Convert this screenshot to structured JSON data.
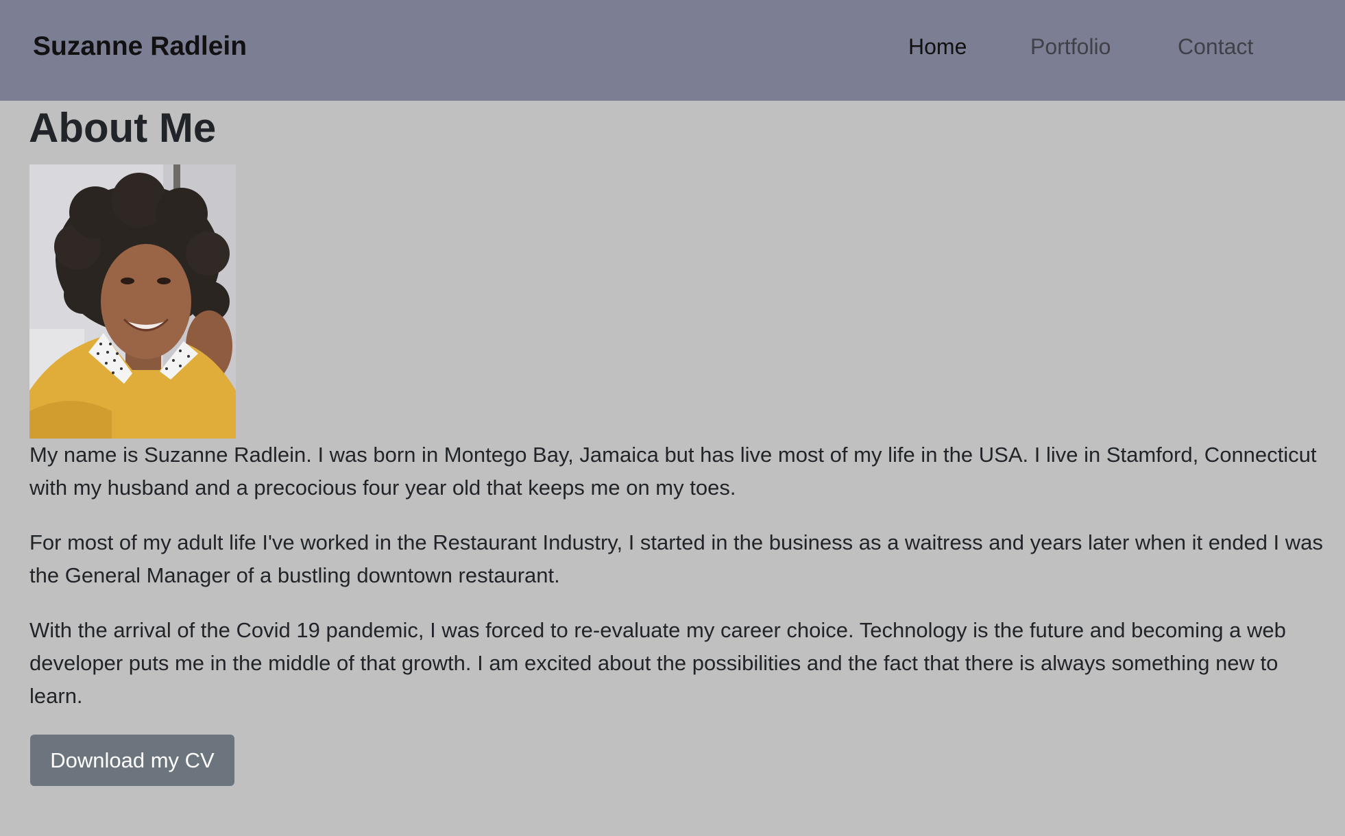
{
  "navbar": {
    "brand": "Suzanne Radlein",
    "links": [
      {
        "label": "Home"
      },
      {
        "label": "Portfolio"
      },
      {
        "label": "Contact"
      }
    ]
  },
  "main": {
    "title": "About Me",
    "paragraphs": [
      "My name is Suzanne Radlein. I was born in Montego Bay, Jamaica but has live most of my life in the USA. I live in Stamford, Connecticut with my husband and a precocious four year old that keeps me on my toes.",
      "For most of my adult life I've worked in the Restaurant Industry, I started in the business as a waitress and years later when it ended I was the General Manager of a bustling downtown restaurant.",
      "With the arrival of the Covid 19 pandemic, I was forced to re-evaluate my career choice. Technology is the future and becoming a web developer puts me in the middle of that growth. I am excited about the possibilities and the fact that there is always something new to learn."
    ],
    "cv_button_label": "Download my CV"
  },
  "colors": {
    "navbar_bg": "#7c7e93",
    "page_bg": "#c0c0c0",
    "button_bg": "#6c757d",
    "text": "#212529"
  }
}
